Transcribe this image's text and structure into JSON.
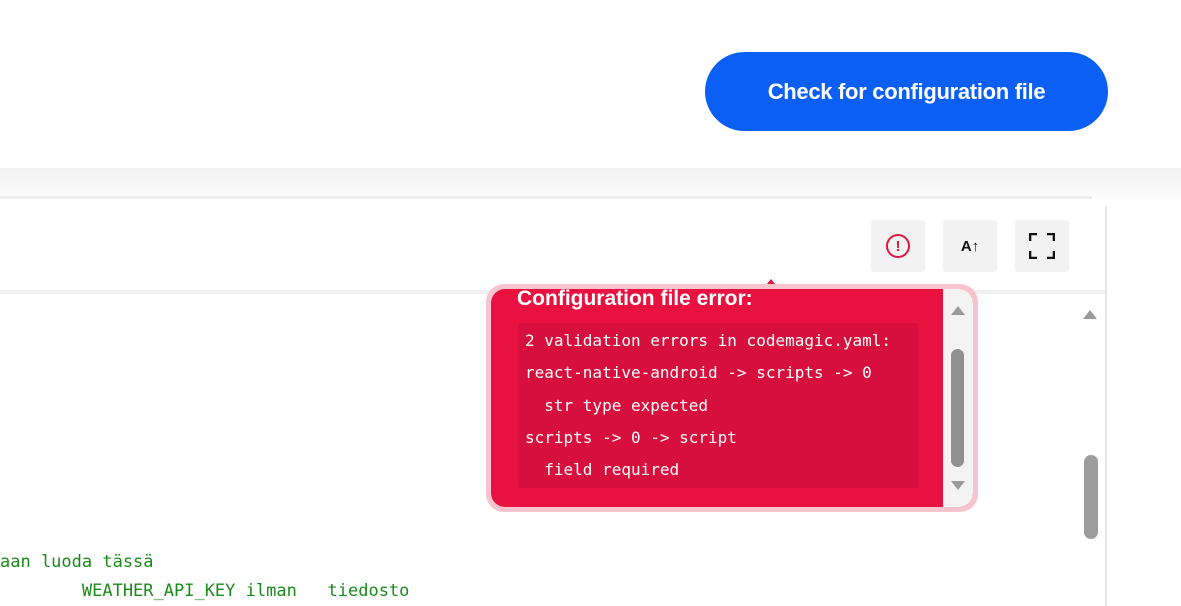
{
  "header": {
    "check_button_label": "Check for configuration file"
  },
  "toolbar": {
    "error_icon": "exclamation-circle-icon",
    "error_glyph": "!",
    "font_size_label": "A↑",
    "fullscreen_icon": "fullscreen-icon"
  },
  "popover": {
    "title": "Configuration file error:",
    "lines": [
      "2 validation errors in codemagic.yaml:",
      "react-native-android -> scripts -> 0",
      "  str type expected",
      "scripts -> 0 -> script",
      "  field required"
    ]
  },
  "editor": {
    "lines": [
      "aan luoda tässä",
      "        WEATHER_API_KEY ilman   tiedosto"
    ]
  },
  "colors": {
    "primary": "#0b5ff5",
    "error": "#e8113f",
    "comment": "#1b8a1b"
  }
}
